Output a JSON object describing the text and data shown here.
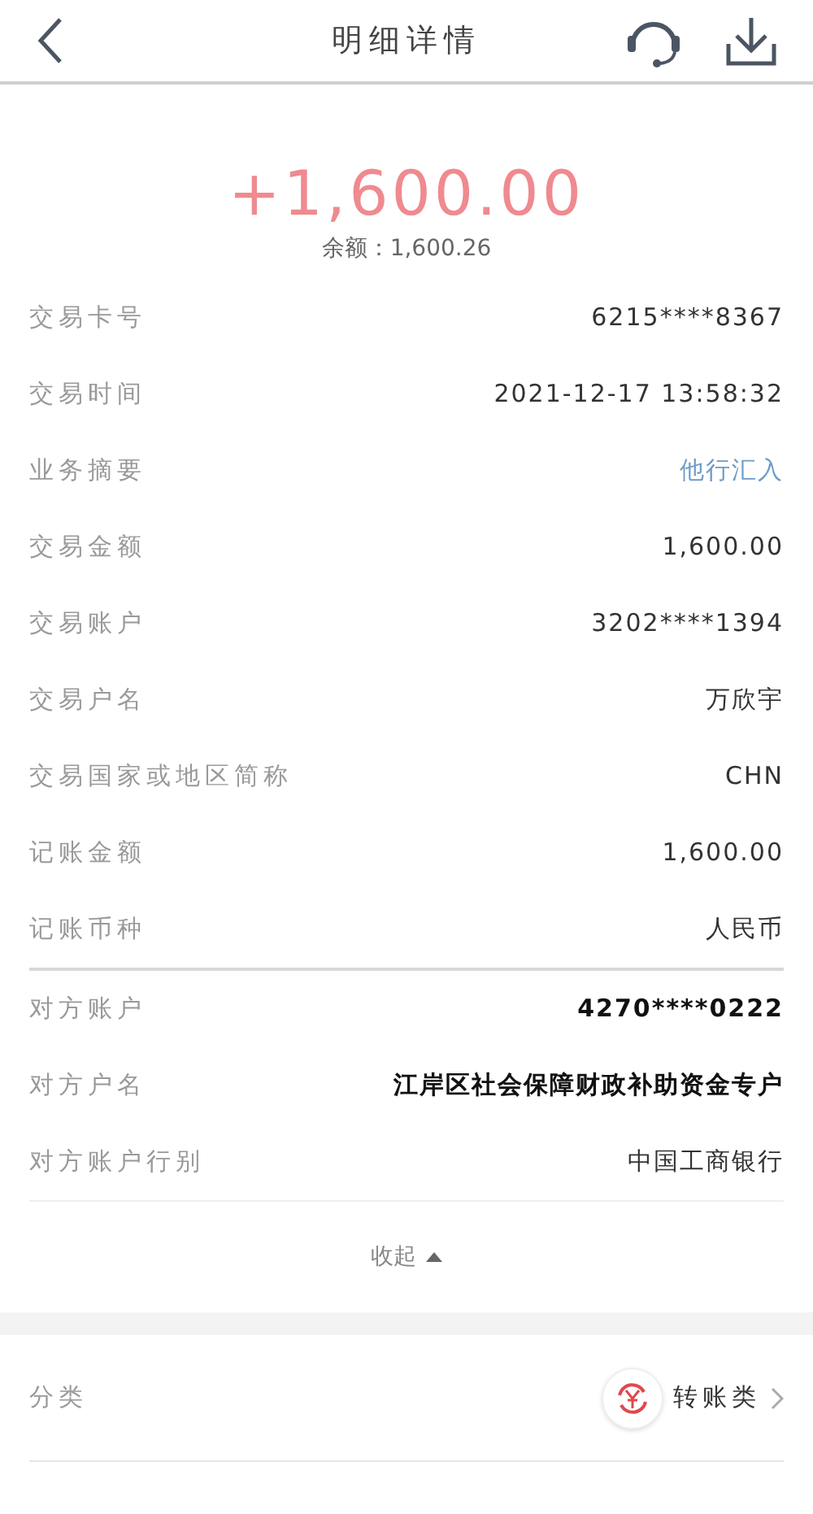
{
  "header": {
    "title": "明细详情"
  },
  "amount": "+1,600.00",
  "balance": "余额：1,600.26",
  "details": [
    {
      "label": "交易卡号",
      "value": "6215****8367",
      "kind": "text"
    },
    {
      "label": "交易时间",
      "value": "2021-12-17 13:58:32",
      "kind": "text"
    },
    {
      "label": "业务摘要",
      "value": "他行汇入",
      "kind": "link"
    },
    {
      "label": "交易金额",
      "value": "1,600.00",
      "kind": "text"
    },
    {
      "label": "交易账户",
      "value": "3202****1394",
      "kind": "text"
    },
    {
      "label": "交易户名",
      "value": "万欣宇",
      "kind": "text"
    },
    {
      "label": "交易国家或地区简称",
      "value": "CHN",
      "kind": "text"
    },
    {
      "label": "记账金额",
      "value": "1,600.00",
      "kind": "text"
    },
    {
      "label": "记账币种",
      "value": "人民币",
      "kind": "text"
    }
  ],
  "counterparty": [
    {
      "label": "对方账户",
      "value": "4270****0222",
      "kind": "strong"
    },
    {
      "label": "对方户名",
      "value": "江岸区社会保障财政补助资金专户",
      "kind": "strong"
    },
    {
      "label": "对方账户行别",
      "value": "中国工商银行",
      "kind": "text"
    }
  ],
  "collapse": {
    "label": "收起",
    "expanded": true
  },
  "category": {
    "label": "分类",
    "value": "转账类"
  }
}
